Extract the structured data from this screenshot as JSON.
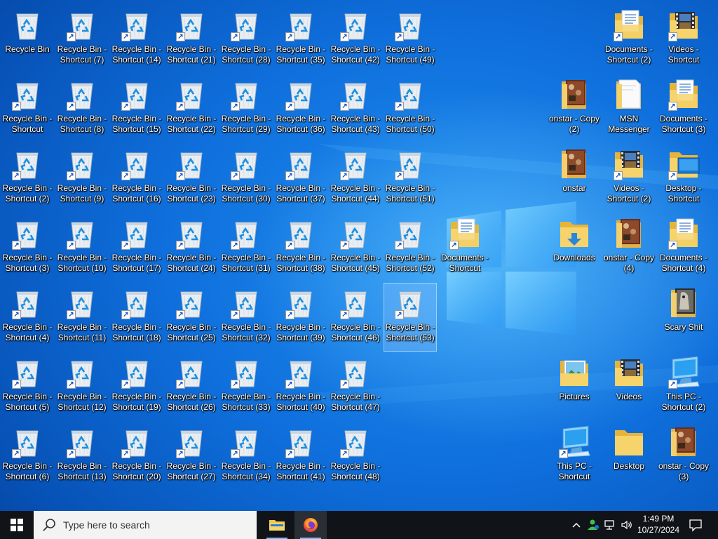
{
  "desktop": {
    "icons": [
      {
        "label": "Recycle Bin",
        "type": "bin",
        "shortcut": false
      },
      {
        "label": "Recycle Bin - Shortcut",
        "type": "bin",
        "shortcut": true
      },
      {
        "label": "Recycle Bin - Shortcut (2)",
        "type": "bin",
        "shortcut": true
      },
      {
        "label": "Recycle Bin - Shortcut (3)",
        "type": "bin",
        "shortcut": true
      },
      {
        "label": "Recycle Bin - Shortcut (4)",
        "type": "bin",
        "shortcut": true
      },
      {
        "label": "Recycle Bin - Shortcut (5)",
        "type": "bin",
        "shortcut": true
      },
      {
        "label": "Recycle Bin - Shortcut (6)",
        "type": "bin",
        "shortcut": true
      },
      {
        "label": "Recycle Bin - Shortcut (7)",
        "type": "bin",
        "shortcut": true
      },
      {
        "label": "Recycle Bin - Shortcut (8)",
        "type": "bin",
        "shortcut": true
      },
      {
        "label": "Recycle Bin - Shortcut (9)",
        "type": "bin",
        "shortcut": true
      },
      {
        "label": "Recycle Bin - Shortcut (10)",
        "type": "bin",
        "shortcut": true
      },
      {
        "label": "Recycle Bin - Shortcut (11)",
        "type": "bin",
        "shortcut": true
      },
      {
        "label": "Recycle Bin - Shortcut (12)",
        "type": "bin",
        "shortcut": true
      },
      {
        "label": "Recycle Bin - Shortcut (13)",
        "type": "bin",
        "shortcut": true
      },
      {
        "label": "Recycle Bin - Shortcut (14)",
        "type": "bin",
        "shortcut": true
      },
      {
        "label": "Recycle Bin - Shortcut (15)",
        "type": "bin",
        "shortcut": true
      },
      {
        "label": "Recycle Bin - Shortcut (16)",
        "type": "bin",
        "shortcut": true
      },
      {
        "label": "Recycle Bin - Shortcut (17)",
        "type": "bin",
        "shortcut": true
      },
      {
        "label": "Recycle Bin - Shortcut (18)",
        "type": "bin",
        "shortcut": true
      },
      {
        "label": "Recycle Bin - Shortcut (19)",
        "type": "bin",
        "shortcut": true
      },
      {
        "label": "Recycle Bin - Shortcut (20)",
        "type": "bin",
        "shortcut": true
      },
      {
        "label": "Recycle Bin - Shortcut (21)",
        "type": "bin",
        "shortcut": true
      },
      {
        "label": "Recycle Bin - Shortcut (22)",
        "type": "bin",
        "shortcut": true
      },
      {
        "label": "Recycle Bin - Shortcut (23)",
        "type": "bin",
        "shortcut": true
      },
      {
        "label": "Recycle Bin - Shortcut (24)",
        "type": "bin",
        "shortcut": true
      },
      {
        "label": "Recycle Bin - Shortcut (25)",
        "type": "bin",
        "shortcut": true
      },
      {
        "label": "Recycle Bin - Shortcut (26)",
        "type": "bin",
        "shortcut": true
      },
      {
        "label": "Recycle Bin - Shortcut (27)",
        "type": "bin",
        "shortcut": true
      },
      {
        "label": "Recycle Bin - Shortcut (28)",
        "type": "bin",
        "shortcut": true
      },
      {
        "label": "Recycle Bin - Shortcut (29)",
        "type": "bin",
        "shortcut": true
      },
      {
        "label": "Recycle Bin - Shortcut (30)",
        "type": "bin",
        "shortcut": true
      },
      {
        "label": "Recycle Bin - Shortcut (31)",
        "type": "bin",
        "shortcut": true
      },
      {
        "label": "Recycle Bin - Shortcut (32)",
        "type": "bin",
        "shortcut": true
      },
      {
        "label": "Recycle Bin - Shortcut (33)",
        "type": "bin",
        "shortcut": true
      },
      {
        "label": "Recycle Bin - Shortcut (34)",
        "type": "bin",
        "shortcut": true
      },
      {
        "label": "Recycle Bin - Shortcut (35)",
        "type": "bin",
        "shortcut": true
      },
      {
        "label": "Recycle Bin - Shortcut (36)",
        "type": "bin",
        "shortcut": true
      },
      {
        "label": "Recycle Bin - Shortcut (37)",
        "type": "bin",
        "shortcut": true
      },
      {
        "label": "Recycle Bin - Shortcut (38)",
        "type": "bin",
        "shortcut": true
      },
      {
        "label": "Recycle Bin - Shortcut (39)",
        "type": "bin",
        "shortcut": true
      },
      {
        "label": "Recycle Bin - Shortcut (40)",
        "type": "bin",
        "shortcut": true
      },
      {
        "label": "Recycle Bin - Shortcut (41)",
        "type": "bin",
        "shortcut": true
      },
      {
        "label": "Recycle Bin - Shortcut (42)",
        "type": "bin",
        "shortcut": true
      },
      {
        "label": "Recycle Bin - Shortcut (43)",
        "type": "bin",
        "shortcut": true
      },
      {
        "label": "Recycle Bin - Shortcut (44)",
        "type": "bin",
        "shortcut": true
      },
      {
        "label": "Recycle Bin - Shortcut (45)",
        "type": "bin",
        "shortcut": true
      },
      {
        "label": "Recycle Bin - Shortcut (46)",
        "type": "bin",
        "shortcut": true
      },
      {
        "label": "Recycle Bin - Shortcut (47)",
        "type": "bin",
        "shortcut": true
      },
      {
        "label": "Recycle Bin - Shortcut (48)",
        "type": "bin",
        "shortcut": true
      },
      {
        "label": "Recycle Bin - Shortcut (49)",
        "type": "bin",
        "shortcut": true
      },
      {
        "label": "Recycle Bin - Shortcut (50)",
        "type": "bin",
        "shortcut": true
      },
      {
        "label": "Recycle Bin - Shortcut (51)",
        "type": "bin",
        "shortcut": true
      },
      {
        "label": "Recycle Bin - Shortcut (52)",
        "type": "bin",
        "shortcut": true
      },
      {
        "label": "Recycle Bin - Shortcut (53)",
        "type": "bin",
        "shortcut": true,
        "selected": true
      },
      {
        "label": "Documents - Shortcut",
        "type": "documents",
        "shortcut": true
      },
      {
        "label": "onstar - Copy (2)",
        "type": "photo-folder",
        "shortcut": false
      },
      {
        "label": "onstar",
        "type": "photo-folder",
        "shortcut": false
      },
      {
        "label": "Downloads",
        "type": "downloads",
        "shortcut": false
      },
      {
        "label": "Pictures",
        "type": "pictures",
        "shortcut": false
      },
      {
        "label": "This PC - Shortcut",
        "type": "pc",
        "shortcut": true
      },
      {
        "label": "Documents - Shortcut (2)",
        "type": "documents",
        "shortcut": true
      },
      {
        "label": "MSN Messenger",
        "type": "msn",
        "shortcut": false
      },
      {
        "label": "Videos - Shortcut (2)",
        "type": "videos",
        "shortcut": true
      },
      {
        "label": "onstar - Copy (4)",
        "type": "photo-folder",
        "shortcut": false
      },
      {
        "label": "Videos",
        "type": "videos",
        "shortcut": false
      },
      {
        "label": "Desktop",
        "type": "folder",
        "shortcut": false
      },
      {
        "label": "Videos - Shortcut",
        "type": "videos",
        "shortcut": true
      },
      {
        "label": "Documents - Shortcut (3)",
        "type": "documents",
        "shortcut": true
      },
      {
        "label": "Desktop - Shortcut",
        "type": "desktop",
        "shortcut": true
      },
      {
        "label": "Documents - Shortcut (4)",
        "type": "documents",
        "shortcut": true
      },
      {
        "label": "Scary Shit",
        "type": "scary-folder",
        "shortcut": false
      },
      {
        "label": "This PC - Shortcut (2)",
        "type": "pc",
        "shortcut": true
      },
      {
        "label": "onstar - Copy (3)",
        "type": "photo-folder",
        "shortcut": false
      }
    ]
  },
  "taskbar": {
    "search_placeholder": "Type here to search",
    "apps": [
      {
        "name": "File Explorer",
        "icon": "folder-icon"
      },
      {
        "name": "Firefox",
        "icon": "firefox-icon"
      }
    ],
    "tray": {
      "time": "1:49 PM",
      "date": "10/27/2024"
    }
  },
  "colors": {
    "taskbar_bg": "#101418",
    "desktop_accent": "#1e8ef0"
  }
}
